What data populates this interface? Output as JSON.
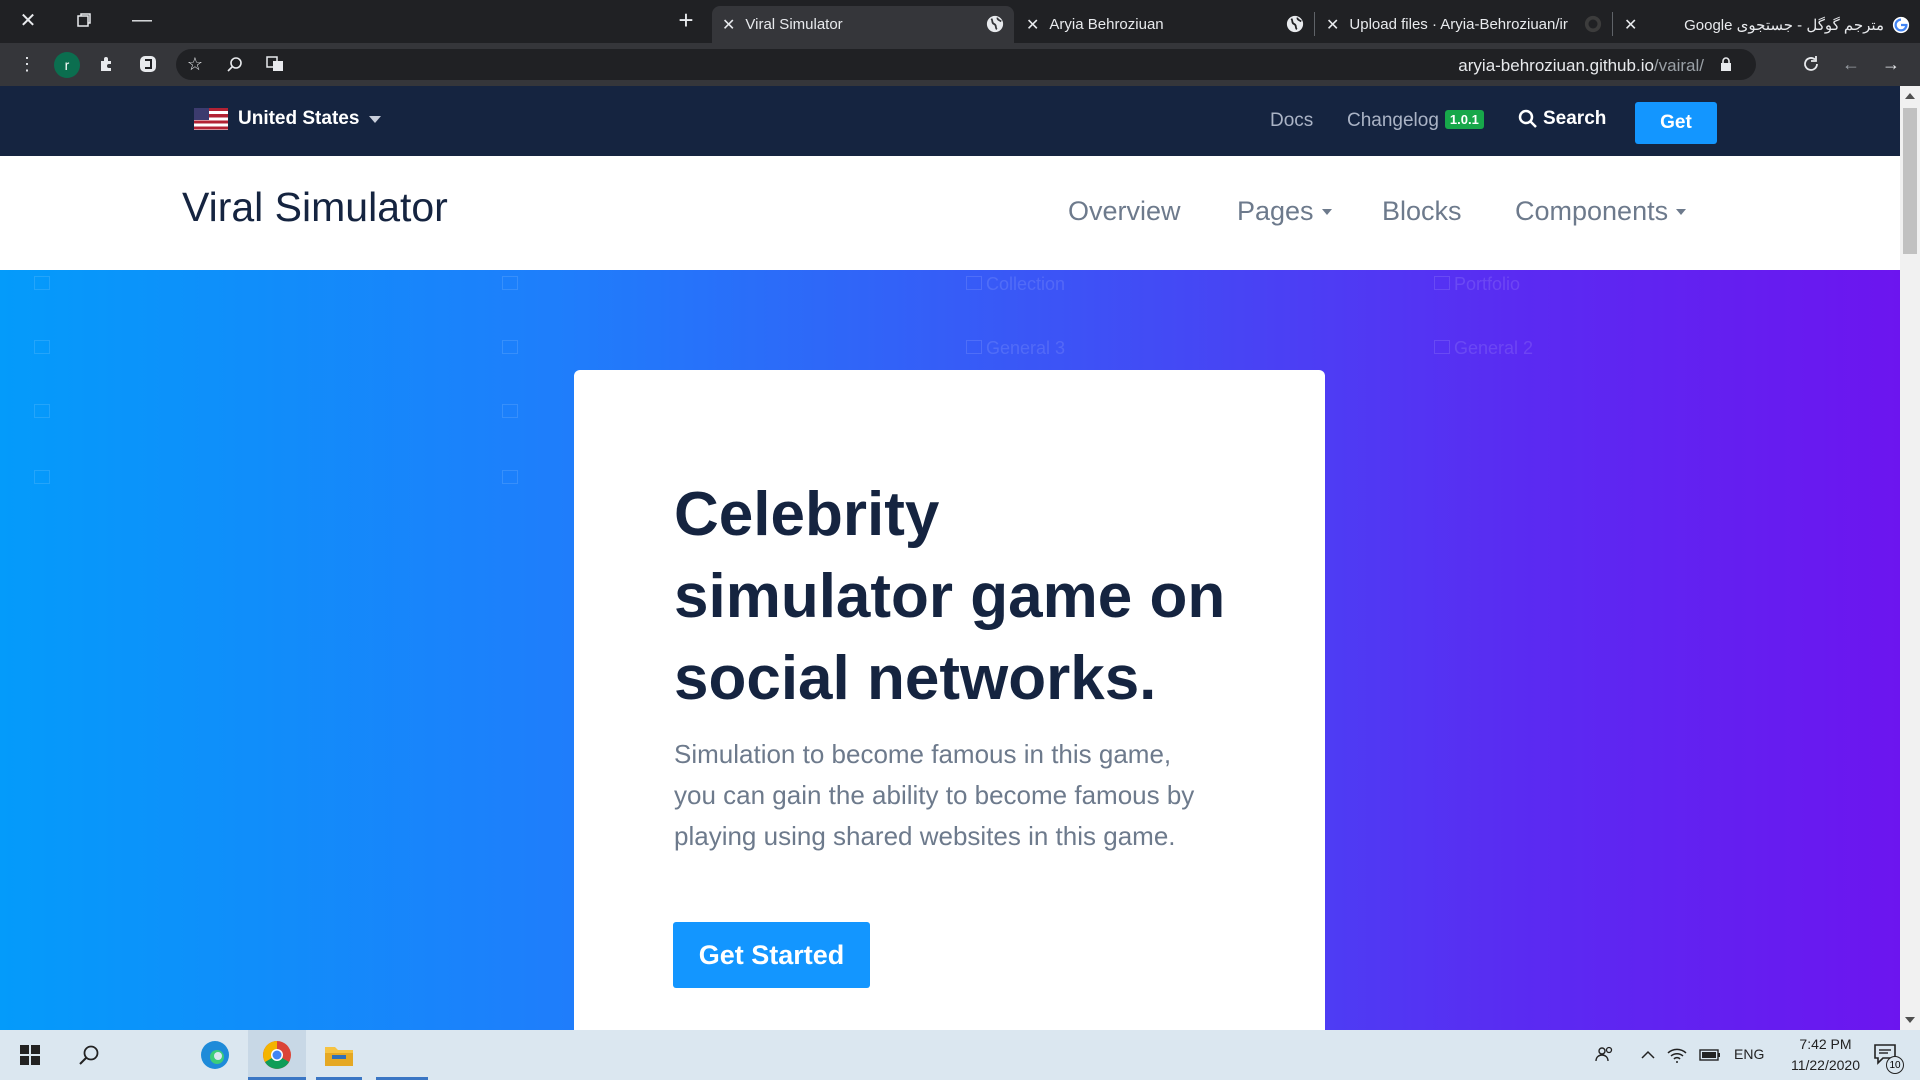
{
  "browser": {
    "tabs": [
      {
        "title": "Viral Simulator",
        "active": true
      },
      {
        "title": "Aryia Behroziuan",
        "active": false
      },
      {
        "title": "Upload files · Aryia-Behroziuan/ir",
        "active": false
      },
      {
        "title": "مترجم گوگل - جستجوی Google",
        "active": false
      }
    ],
    "avatar_letter": "r",
    "url_host": "aryia-behroziuan.github.io",
    "url_path": "/vairal/"
  },
  "site_topbar": {
    "country": "United States",
    "docs": "Docs",
    "changelog": "Changelog",
    "version": "1.0.1",
    "search": "Search",
    "get": "Get"
  },
  "navbar": {
    "brand": "Viral Simulator",
    "items": [
      "Overview",
      "Pages",
      "Blocks",
      "Components"
    ]
  },
  "hero": {
    "title": "Celebrity simulator game on social networks.",
    "text": "Simulation to become famous in this game, you can gain the ability to become famous by playing using shared websites in this game.",
    "cta": "Get Started",
    "broken_images": [
      "Portfolio",
      "General 2",
      "General 3",
      "Collection"
    ]
  },
  "taskbar": {
    "lang": "ENG",
    "time": "7:42 PM",
    "date": "11/22/2020",
    "notifications": "10"
  },
  "colors": {
    "primary": "#1396ff",
    "navy": "#152440",
    "badge": "#17a74a"
  }
}
